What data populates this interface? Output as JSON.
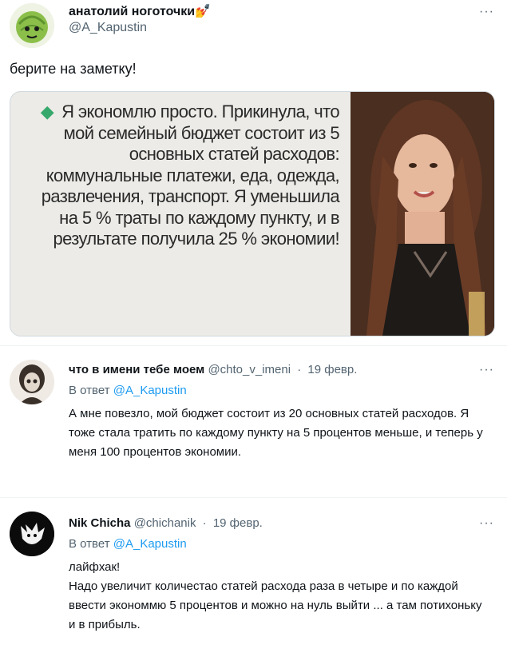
{
  "main_tweet": {
    "author_name": "анатолий ноготочки💅",
    "author_handle": "@A_Kapustin",
    "text": "берите на заметку!",
    "media_text": "Я экономлю просто. Прикинула, что мой семейный бюджет состоит из 5 основных статей расходов: коммунальные платежи, еда, одежда, развлечения, транспорт. Я уменьшила на 5 % траты по каждому пункту, и в результате получила 25 % экономии!",
    "more_label": "···"
  },
  "replies": [
    {
      "author_name": "что в имени тебе моем",
      "author_handle": "@chto_v_imeni",
      "date": "19 февр.",
      "reply_prefix": "В ответ",
      "reply_to": "@A_Kapustin",
      "text": "А мне повезло, мой бюджет состоит из 20 основных статей расходов. Я тоже стала тратить по каждому пункту на 5 процентов меньше, и теперь у меня 100 процентов экономии.",
      "more_label": "···"
    },
    {
      "author_name": "Nik Chicha",
      "author_handle": "@chichanik",
      "date": "19 февр.",
      "reply_prefix": "В ответ",
      "reply_to": "@A_Kapustin",
      "text_line1": "лайфхак!",
      "text_line2": "Надо увеличит количестао статей расхода раза в четыре  и по каждой ввести экономмю 5 процентов и можно на нуль выйти ... а там потихоньку и в прибыль.",
      "more_label": "···"
    }
  ],
  "colors": {
    "link": "#1d9bf0",
    "secondary_text": "#536471",
    "primary_text": "#0f1419",
    "bullet": "#36a86b"
  }
}
